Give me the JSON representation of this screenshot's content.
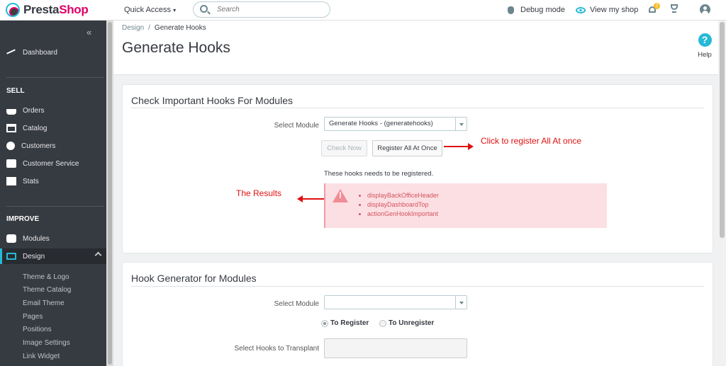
{
  "brand": {
    "presta": "Presta",
    "shop": "Shop"
  },
  "topbar": {
    "quick_access": "Quick Access",
    "search_placeholder": "Search",
    "debug_mode": "Debug mode",
    "view_shop": "View my shop",
    "notification_count": "2"
  },
  "sidebar": {
    "collapse": "«",
    "dashboard": "Dashboard",
    "sell_title": "SELL",
    "sell_items": [
      "Orders",
      "Catalog",
      "Customers",
      "Customer Service",
      "Stats"
    ],
    "improve_title": "IMPROVE",
    "modules": "Modules",
    "design": "Design",
    "design_sub": [
      "Theme & Logo",
      "Theme Catalog",
      "Email Theme",
      "Pages",
      "Positions",
      "Image Settings",
      "Link Widget"
    ]
  },
  "header": {
    "breadcrumb_parent": "Design",
    "breadcrumb_sep": "/",
    "breadcrumb_current": "Generate Hooks",
    "title": "Generate Hooks",
    "help": "Help",
    "help_icon": "?"
  },
  "panel1": {
    "title": "Check Important Hooks For Modules",
    "select_label": "Select Module",
    "select_value": "Generate Hooks - (generatehooks)",
    "check_now": "Check Now",
    "register_all": "Register All At Once",
    "hint": "These hooks needs to be registered.",
    "hooks": [
      "displayBackOfficeHeader",
      "displayDashboardTop",
      "actionGenHookImportant"
    ],
    "annotation_register": "Click to register All At once",
    "annotation_results": "The Results"
  },
  "panel2": {
    "title": "Hook Generator for Modules",
    "select_label": "Select Module",
    "select_value": "",
    "radio_register": "To Register",
    "radio_unregister": "To Unregister",
    "transplant_label": "Select Hooks to Transplant"
  },
  "colors": {
    "accent": "#25b9d7",
    "brand_pink": "#df0067",
    "sidebar_bg": "#363a41",
    "alert_bg": "#fcdfe3",
    "annotation": "#e01010"
  }
}
